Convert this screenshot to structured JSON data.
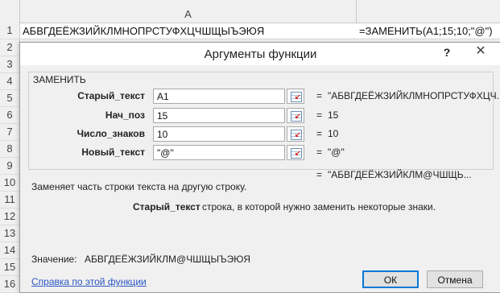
{
  "sheet": {
    "column_header": "A",
    "rows": [
      "1",
      "2",
      "3",
      "4",
      "5",
      "6",
      "7",
      "8",
      "9",
      "10",
      "11",
      "12",
      "13",
      "14",
      "15",
      "16"
    ],
    "cell_a1": "АБВГДЕЁЖЗИЙКЛМНОПРСТУФХЦЧШЩЫЪЭЮЯ",
    "cell_b1": "=ЗАМЕНИТЬ(A1;15;10;\"@\")"
  },
  "dialog": {
    "title": "Аргументы функции",
    "help": "?",
    "close": "✕",
    "function_name": "ЗАМЕНИТЬ",
    "args": [
      {
        "label": "Старый_текст",
        "value": "A1",
        "eq": "=",
        "result": "\"АБВГДЕЁЖЗИЙКЛМНОПРСТУФХЦЧ..."
      },
      {
        "label": "Нач_поз",
        "value": "15",
        "eq": "=",
        "result": "15"
      },
      {
        "label": "Число_знаков",
        "value": "10",
        "eq": "=",
        "result": "10"
      },
      {
        "label": "Новый_текст",
        "value": "\"@\"",
        "eq": "=",
        "result": "\"@\""
      }
    ],
    "formula_eq": "=",
    "formula_result": "\"АБВГДЕЁЖЗИЙКЛМ@ЧШЩЬ...",
    "description": "Заменяет часть строки текста на другую строку.",
    "arg_desc_name": "Старый_текст",
    "arg_desc_text": "строка, в которой нужно заменить некоторые знаки.",
    "value_label": "Значение:",
    "value_text": "АБВГДЕЁЖЗИЙКЛМ@ЧШЩЫЪЭЮЯ",
    "help_link": "Справка по этой функции",
    "ok": "ОК",
    "cancel": "Отмена"
  },
  "colors": {
    "link": "#2b56c6",
    "ok_border": "#0078d7"
  },
  "icons": {
    "collapse": "collapse-dialog-icon"
  }
}
